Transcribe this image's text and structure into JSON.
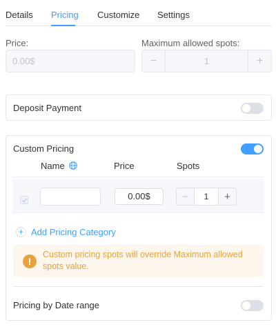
{
  "tabs": [
    {
      "label": "Details",
      "active": false
    },
    {
      "label": "Pricing",
      "active": true
    },
    {
      "label": "Customize",
      "active": false
    },
    {
      "label": "Settings",
      "active": false
    }
  ],
  "price": {
    "label": "Price:",
    "placeholder": "0.00$"
  },
  "max_spots": {
    "label": "Maximum allowed spots:",
    "value": "1"
  },
  "deposit": {
    "label": "Deposit Payment",
    "enabled": false
  },
  "custom_pricing": {
    "label": "Custom Pricing",
    "enabled": true,
    "columns": {
      "name": "Name",
      "price": "Price",
      "spots": "Spots"
    },
    "rows": [
      {
        "checked": true,
        "name": "",
        "price": "0.00$",
        "spots": "1"
      }
    ],
    "add_label": "Add Pricing Category",
    "warning": "Custom pricing spots will override Maximum allowed spots value."
  },
  "date_range": {
    "label": "Pricing by Date range",
    "enabled": false
  },
  "colors": {
    "accent": "#409eff",
    "warning": "#e6a23c",
    "warning_bg": "#fdf6ec"
  }
}
